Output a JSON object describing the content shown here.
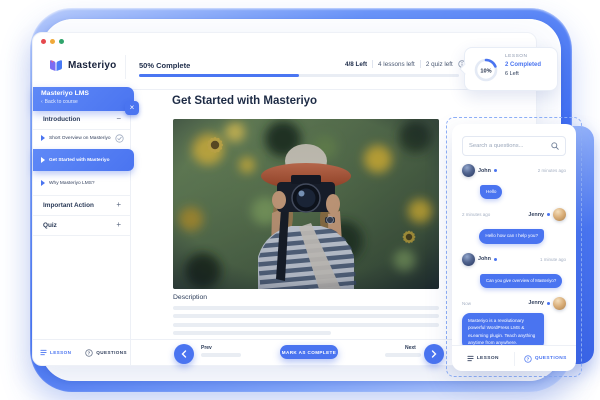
{
  "colors": {
    "primary": "#4a74f0",
    "traffic_red": "#e5484d",
    "traffic_yellow": "#f0a93a",
    "traffic_green": "#30a46c"
  },
  "window": {
    "header": {
      "logo_text": "Masteriyo",
      "progress_label": "50% Complete",
      "progress_percent": 50,
      "stats": [
        "4/8 Left",
        "4 lessons left",
        "2 quiz left"
      ]
    }
  },
  "tooltip": {
    "percent": "10%",
    "percent_value": 10,
    "title": "LESSON",
    "completed": "2 Completed",
    "remaining": "6 Left"
  },
  "sidebar": {
    "course_title": "Masteriyo LMS",
    "back_label": "Back to course",
    "sections": [
      {
        "label": "Introduction",
        "toggle": "−",
        "items": [
          {
            "label": "Short Overview on Masteriyo",
            "completed": true
          },
          {
            "label": "Get Started with Masteriyo",
            "active": true
          },
          {
            "label": "Why Masteriyo LMS?"
          }
        ]
      },
      {
        "label": "Important Action",
        "toggle": "+"
      },
      {
        "label": "Quiz",
        "toggle": "+"
      }
    ],
    "footer": {
      "lesson": "LESSON",
      "questions": "QUESTIONS"
    }
  },
  "main": {
    "title": "Get Started with Masteriyo",
    "description_label": "Description",
    "prev_label": "Prev",
    "next_label": "Next",
    "complete_button": "MARK AS COMPLETE"
  },
  "chat": {
    "search_placeholder": "Search a questions...",
    "messages": [
      {
        "name": "John",
        "time": "2 minutes ago",
        "text": "Hello"
      },
      {
        "name": "Jenny",
        "time": "2 minutes ago",
        "text": "Hello how can I help you?"
      },
      {
        "name": "John",
        "time": "1 minute ago",
        "text": "Can you give overview of Masteriyo?"
      },
      {
        "name": "Jenny",
        "time": "Now",
        "text": "Masteriyo is a revolutionary powerful WordPress LMS & eLearning plugin. Teach anything anytime from anywhere."
      }
    ],
    "footer": {
      "lesson": "LESSON",
      "questions": "QUESTIONS"
    }
  }
}
